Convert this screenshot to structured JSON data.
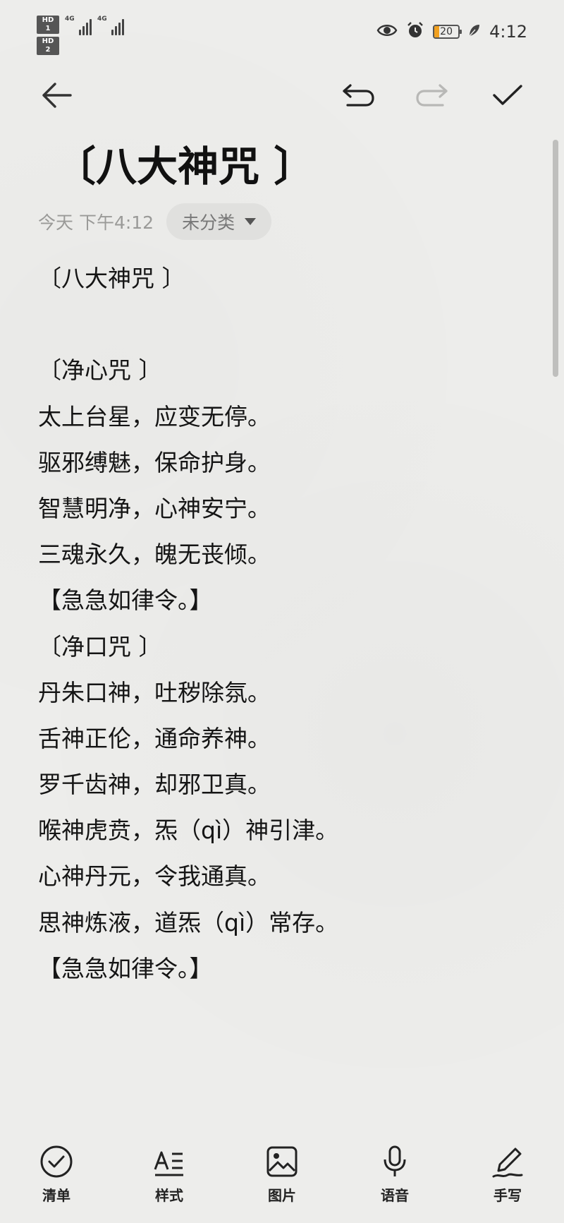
{
  "status_bar": {
    "sim1_badge": "HD 1",
    "sim2_badge": "HD 2",
    "net1": "4G",
    "net2": "4G",
    "battery_level": "20",
    "time": "4:12",
    "icons": [
      "eye-icon",
      "alarm-icon",
      "battery-icon",
      "leaf-icon"
    ]
  },
  "toolbar": {
    "back_icon": "arrow-left-icon",
    "undo_icon": "undo-icon",
    "redo_icon": "redo-icon",
    "done_icon": "checkmark-icon"
  },
  "note": {
    "title": "〔八大神咒 〕",
    "date": "今天 下午4:12",
    "category": "未分类",
    "lines": [
      "〔八大神咒 〕",
      "",
      "〔净心咒 〕",
      "太上台星，应变无停。",
      "驱邪缚魅，保命护身。",
      "智慧明净，心神安宁。",
      "三魂永久，魄无丧倾。",
      "【急急如律令。】",
      "〔净口咒 〕",
      "丹朱口神，吐秽除氛。",
      "舌神正伦，通命养神。",
      "罗千齿神，却邪卫真。",
      "喉神虎贲，炁（qì）神引津。",
      "心神丹元，令我通真。",
      "思神炼液，道炁（qì）常存。",
      "【急急如律令。】"
    ]
  },
  "bottom_bar": {
    "items": [
      {
        "label": "清单",
        "icon": "checklist-icon"
      },
      {
        "label": "样式",
        "icon": "text-style-icon"
      },
      {
        "label": "图片",
        "icon": "image-icon"
      },
      {
        "label": "语音",
        "icon": "microphone-icon"
      },
      {
        "label": "手写",
        "icon": "pen-icon"
      }
    ]
  }
}
